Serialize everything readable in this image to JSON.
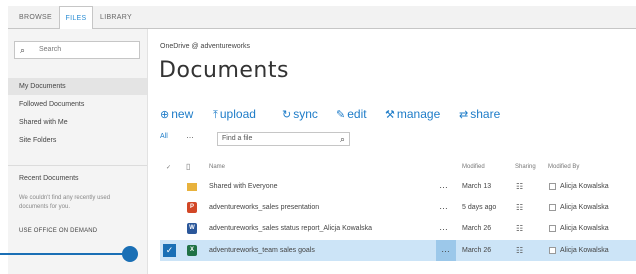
{
  "ribbon": {
    "tabs": [
      {
        "label": "BROWSE"
      },
      {
        "label": "FILES"
      },
      {
        "label": "LIBRARY"
      }
    ]
  },
  "leftnav": {
    "search_placeholder": "Search",
    "links": [
      {
        "label": "My Documents",
        "selected": true
      },
      {
        "label": "Followed Documents"
      },
      {
        "label": "Shared with Me"
      },
      {
        "label": "Site Folders"
      }
    ],
    "recent_heading": "Recent Documents",
    "recent_note": "We couldn't find any recently used documents for you.",
    "demand_link": "USE OFFICE ON DEMAND"
  },
  "main": {
    "breadcrumb": "OneDrive @ adventureworks",
    "title": "Documents",
    "commands": [
      {
        "icon": "new-icon",
        "label": "new"
      },
      {
        "icon": "upload-icon",
        "label": "upload"
      },
      {
        "icon": "sync-icon",
        "label": "sync"
      },
      {
        "icon": "edit-icon",
        "label": "edit"
      },
      {
        "icon": "manage-icon",
        "label": "manage"
      },
      {
        "icon": "share-icon",
        "label": "share"
      }
    ],
    "view_all": "All",
    "view_more": "…",
    "find_placeholder": "Find a file",
    "columns": {
      "check": "✓",
      "type": "▯",
      "name": "Name",
      "modified": "Modified",
      "sharing": "Sharing",
      "modified_by": "Modified By"
    },
    "rows": [
      {
        "type": "folder",
        "type_glyph": "",
        "name": "Shared with Everyone",
        "modified": "March 13",
        "modified_by": "Alicja Kowalska",
        "selected": false
      },
      {
        "type": "powerpoint",
        "type_glyph": "P",
        "name": "adventureworks_sales presentation",
        "modified": "5 days ago",
        "modified_by": "Alicja Kowalska",
        "selected": false
      },
      {
        "type": "word",
        "type_glyph": "W",
        "name": "adventureworks_sales status report_Alicja Kowalska",
        "modified": "March 26",
        "modified_by": "Alicja Kowalska",
        "selected": false
      },
      {
        "type": "excel",
        "type_glyph": "X",
        "name": "adventureworks_team sales goals",
        "modified": "March 26",
        "modified_by": "Alicja Kowalska",
        "selected": true
      }
    ],
    "row_menu": "…",
    "share_glyph": "☷",
    "selected_check": "✓"
  },
  "colors": {
    "accent": "#1e7cc8",
    "callout": "#1a6fb5",
    "selected_row": "#cce4f7"
  }
}
